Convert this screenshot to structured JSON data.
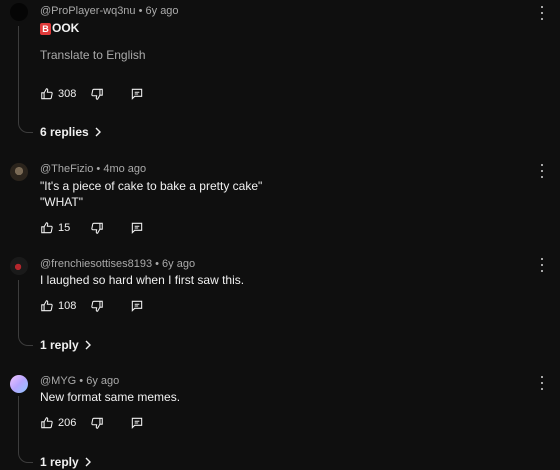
{
  "comments": [
    {
      "handle": "@ProPlayer-wq3nu",
      "time": "• 6y ago",
      "badge_letter": "B",
      "text_rest": "OOK",
      "translate": "Translate to English",
      "likes": "308",
      "replies": "6 replies"
    },
    {
      "handle": "@TheFizio",
      "time": "• 4mo ago",
      "line1": "\"It's a piece of cake to bake a pretty cake\"",
      "line2": "\"WHAT\"",
      "likes": "15"
    },
    {
      "handle": "@frenchiesottises8193",
      "time": "• 6y ago",
      "line1": "I laughed so hard when I first saw this.",
      "likes": "108",
      "replies": "1 reply"
    },
    {
      "handle": "@MYG",
      "time": "• 6y ago",
      "line1": "New format same memes.",
      "likes": "206",
      "replies": "1 reply"
    }
  ],
  "icons": {
    "like": "thumb-up-icon",
    "dislike": "thumb-down-icon",
    "reply": "comment-reply-icon",
    "more": "more-vertical-icon",
    "chevron": "chevron-right-icon"
  },
  "colors": {
    "background": "#0f0f0f",
    "text": "#f1f1f1",
    "muted": "#aaaaaa",
    "badge": "#e03a3a"
  }
}
